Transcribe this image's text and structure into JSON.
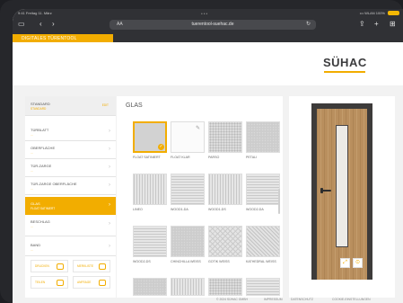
{
  "status_bar": {
    "time": "9:41  Freitag 11. März",
    "signal": "••• WLAN 100%"
  },
  "browser": {
    "url_left": "AA",
    "url": "tuerentool-suehac.de",
    "tab_title": "DIGITALES TÜRENTOOL"
  },
  "brand": {
    "logo": "SÜHAC",
    "accent": "#f2ad00"
  },
  "sidebar": {
    "header": {
      "label": "STANDARD",
      "sub": "STANDARD",
      "edit": "EDIT"
    },
    "items": [
      {
        "label": "TÜRBLATT",
        "sub": "…"
      },
      {
        "label": "OBERFLÄCHE",
        "sub": "…"
      },
      {
        "label": "TÜR-ZARGE",
        "sub": "…"
      },
      {
        "label": "TÜR-ZARGE OBERFLÄCHE",
        "sub": "…"
      },
      {
        "label": "GLAS",
        "sub": "FLOAT SATINIERT",
        "active": true
      },
      {
        "label": "BESCHLAG",
        "sub": "…"
      },
      {
        "label": "BAND",
        "sub": "…"
      }
    ],
    "buttons": [
      {
        "label": "DRUCKEN"
      },
      {
        "label": "MERKLISTE"
      },
      {
        "label": "TEILEN"
      },
      {
        "label": "ANFRAGE"
      }
    ]
  },
  "glass": {
    "title": "GLAS",
    "swatches": [
      {
        "label": "FLOAT SATINIERT",
        "texture": "frost",
        "selected": true
      },
      {
        "label": "FLOAT KLAR",
        "texture": "clear"
      },
      {
        "label": "PARSO",
        "texture": "dots"
      },
      {
        "label": "PETALI",
        "texture": "grain"
      },
      {
        "label": "LINEO",
        "texture": "vline"
      },
      {
        "label": "WOOD1-DA",
        "texture": "hline"
      },
      {
        "label": "WOOD1-DS",
        "texture": "vline"
      },
      {
        "label": "WOOD2-DA",
        "texture": "hline"
      },
      {
        "label": "WOOD2-DS",
        "texture": "hline"
      },
      {
        "label": "CHINCHILLA WEISS",
        "texture": "grain"
      },
      {
        "label": "GOTIK WEISS",
        "texture": "cross"
      },
      {
        "label": "KATHEDRAL WEISS",
        "texture": "diag"
      },
      {
        "label": "",
        "texture": "grain"
      },
      {
        "label": "",
        "texture": "vline"
      },
      {
        "label": "",
        "texture": "dots"
      },
      {
        "label": "",
        "texture": "hline"
      }
    ]
  },
  "preview": {
    "btn_left": "⤢",
    "btn_right": "⊙"
  },
  "footer": {
    "copyright": "© 2024 SÜHAC GMBH",
    "links": [
      "IMPRESSUM",
      "DATENSCHUTZ",
      "COOKIE-EINSTELLUNGEN"
    ]
  }
}
